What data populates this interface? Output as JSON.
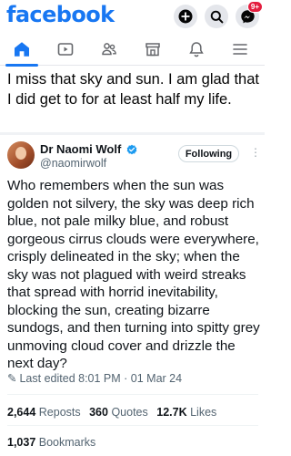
{
  "app": {
    "name": "facebook",
    "badge_count": "9+"
  },
  "nav": {
    "items": [
      {
        "id": "home",
        "icon": "home-icon",
        "active": true
      },
      {
        "id": "video",
        "icon": "video-icon",
        "active": false
      },
      {
        "id": "friends",
        "icon": "friends-icon",
        "active": false
      },
      {
        "id": "marketplace",
        "icon": "marketplace-icon",
        "active": false
      },
      {
        "id": "notifications",
        "icon": "bell-icon",
        "active": false
      },
      {
        "id": "menu",
        "icon": "menu-icon",
        "active": false
      }
    ]
  },
  "post": {
    "text": "I miss that sky and sun.  I am glad that I did get to for at least half my life."
  },
  "tweet": {
    "author_name": "Dr Naomi Wolf",
    "handle": "@naomirwolf",
    "follow_label": "Following",
    "body": "Who remembers when the sun was golden not silvery, the sky was deep rich blue, not pale milky blue, and robust gorgeous cirrus clouds were everywhere, crisply delineated in the sky; when the sky was not plagued with weird streaks that spread with horrid inevitability, blocking the sun, creating bizarre sundogs, and then turning into spitty grey unmoving cloud cover and drizzle the next day?",
    "edited": "Last edited 8:01 PM · 01 Mar 24",
    "reposts_count": "2,644",
    "reposts_label": "Reposts",
    "quotes_count": "360",
    "quotes_label": "Quotes",
    "likes_count": "12.7K",
    "likes_label": "Likes",
    "bookmarks_count": "1,037",
    "bookmarks_label": "Bookmarks"
  },
  "colors": {
    "brand": "#1877f2",
    "badge": "#e41e3f",
    "verified": "#1d9bf0"
  }
}
